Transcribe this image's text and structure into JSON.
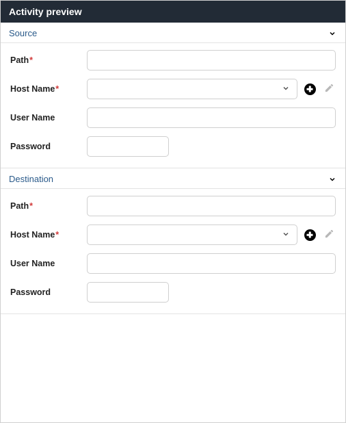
{
  "header": {
    "title": "Activity preview"
  },
  "sections": {
    "source": {
      "title": "Source",
      "fields": {
        "path": {
          "label": "Path",
          "required": true,
          "value": ""
        },
        "hostname": {
          "label": "Host Name",
          "required": true,
          "value": ""
        },
        "username": {
          "label": "User Name",
          "required": false,
          "value": ""
        },
        "password": {
          "label": "Password",
          "required": false,
          "value": ""
        }
      }
    },
    "destination": {
      "title": "Destination",
      "fields": {
        "path": {
          "label": "Path",
          "required": true,
          "value": ""
        },
        "hostname": {
          "label": "Host Name",
          "required": true,
          "value": ""
        },
        "username": {
          "label": "User Name",
          "required": false,
          "value": ""
        },
        "password": {
          "label": "Password",
          "required": false,
          "value": ""
        }
      }
    }
  },
  "required_marker": "*"
}
